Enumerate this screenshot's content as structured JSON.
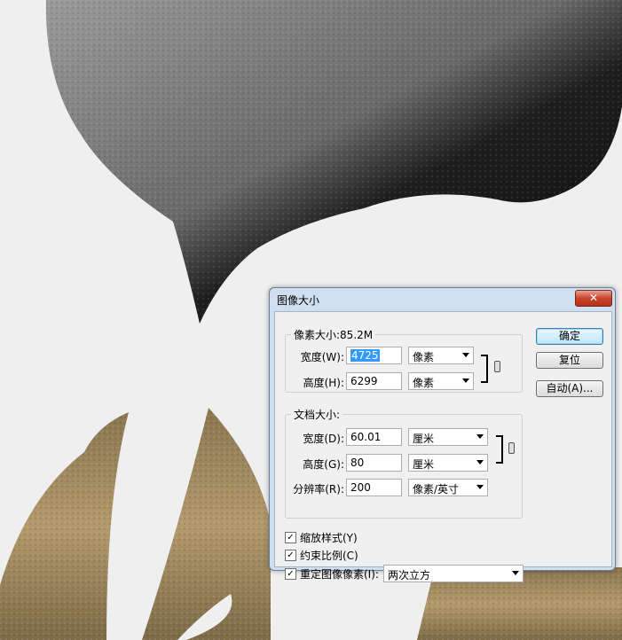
{
  "dialog": {
    "title": "图像大小",
    "close_glyph": "✕",
    "pixel_dimensions": {
      "legend": "像素大小:85.2M",
      "width_label": "宽度(W):",
      "width_value": "4725",
      "width_unit": "像素",
      "height_label": "高度(H):",
      "height_value": "6299",
      "height_unit": "像素"
    },
    "document_size": {
      "legend": "文档大小:",
      "width_label": "宽度(D):",
      "width_value": "60.01",
      "width_unit": "厘米",
      "height_label": "高度(G):",
      "height_value": "80",
      "height_unit": "厘米",
      "resolution_label": "分辨率(R):",
      "resolution_value": "200",
      "resolution_unit": "像素/英寸"
    },
    "options": {
      "scale_styles": "缩放样式(Y)",
      "constrain": "约束比例(C)",
      "resample": "重定图像像素(I):",
      "resample_method": "两次立方"
    },
    "buttons": {
      "ok": "确定",
      "reset": "复位",
      "auto": "自动(A)..."
    }
  },
  "colors": {
    "selection": "#3399ff",
    "titlebar": "#cfdff0",
    "close": "#c8432a"
  }
}
